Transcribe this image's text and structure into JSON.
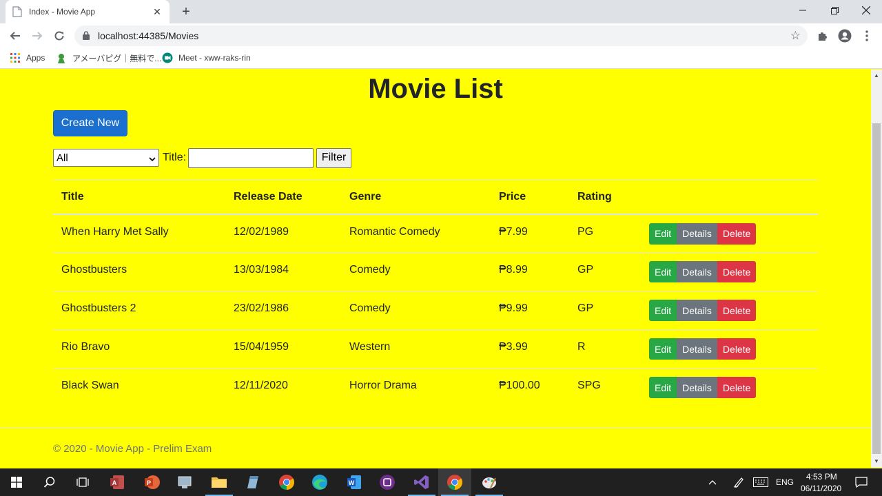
{
  "browser": {
    "tab_title": "Index - Movie App",
    "url": "localhost:44385/Movies",
    "bookmarks": [
      {
        "label": "Apps",
        "icon": "apps-grid-icon"
      },
      {
        "label": "アメーバピグ｜無料で...",
        "icon": "ameba-pigg-icon"
      },
      {
        "label": "Meet - xww-raks-rin",
        "icon": "meet-icon"
      }
    ]
  },
  "page": {
    "title": "Movie List",
    "create_label": "Create New",
    "filter": {
      "genre_selected": "All",
      "title_label": "Title:",
      "title_value": "",
      "filter_label": "Filter"
    },
    "table": {
      "headers": [
        "Title",
        "Release Date",
        "Genre",
        "Price",
        "Rating"
      ],
      "rows": [
        {
          "title": "When Harry Met Sally",
          "release": "12/02/1989",
          "genre": "Romantic Comedy",
          "price": "₱7.99",
          "rating": "PG"
        },
        {
          "title": "Ghostbusters",
          "release": "13/03/1984",
          "genre": "Comedy",
          "price": "₱8.99",
          "rating": "GP"
        },
        {
          "title": "Ghostbusters 2",
          "release": "23/02/1986",
          "genre": "Comedy",
          "price": "₱9.99",
          "rating": "GP"
        },
        {
          "title": "Rio Bravo",
          "release": "15/04/1959",
          "genre": "Western",
          "price": "₱3.99",
          "rating": "R"
        },
        {
          "title": "Black Swan",
          "release": "12/11/2020",
          "genre": "Horror Drama",
          "price": "₱100.00",
          "rating": "SPG"
        }
      ],
      "actions": {
        "edit": "Edit",
        "details": "Details",
        "delete": "Delete"
      }
    },
    "footer": "© 2020 - Movie App - Prelim Exam",
    "background_color": "#ffff00"
  },
  "taskbar": {
    "language": "ENG",
    "time": "4:53 PM",
    "date": "06/11/2020"
  }
}
